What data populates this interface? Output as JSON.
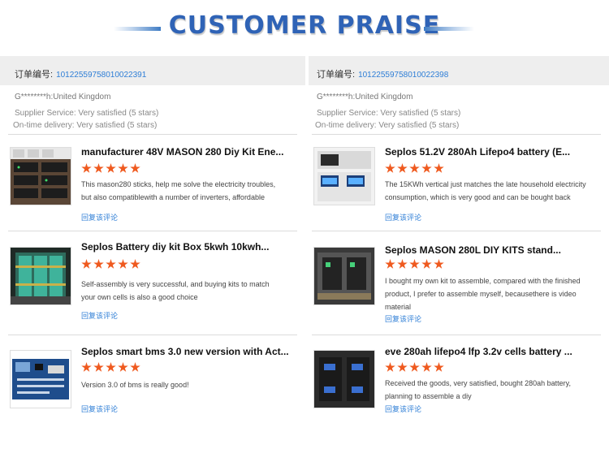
{
  "header": {
    "title": "CUSTOMER PRAISE"
  },
  "columns": [
    {
      "order_label": "订单编号:",
      "order_number": "10122559758010022391",
      "buyer": "G********h:United Kingdom",
      "supplier_service": "Supplier Service: Very satisfied (5 stars)",
      "delivery": "On-time delivery: Very satisfied (5 stars)",
      "items": [
        {
          "title": "manufacturer 48V MASON 280 Diy Kit Ene...",
          "stars": 5,
          "review_1": "This mason280 sticks, help me solve the electricity troubles,",
          "review_2": " but also compatiblewith a number of inverters, affordable",
          "review_3": "",
          "reply": "回复该评论"
        },
        {
          "title": "Seplos Battery diy kit Box 5kwh 10kwh...",
          "stars": 5,
          "review_1": "Self-assembly is very successful, and buying kits to match",
          "review_2": " your own cells is also a good choice",
          "review_3": "",
          "reply": "回复该评论"
        },
        {
          "title": "Seplos smart bms 3.0 new version with Act...",
          "stars": 5,
          "review_1": "Version 3.0 of bms is really good!",
          "review_2": "",
          "review_3": "",
          "reply": "回复该评论"
        }
      ]
    },
    {
      "order_label": "订单编号:",
      "order_number": "10122559758010022398",
      "buyer": "G********h:United Kingdom",
      "supplier_service": "Supplier Service: Very satisfied (5 stars)",
      "delivery": "On-time delivery: Very satisfied (5 stars)",
      "items": [
        {
          "title": "Seplos 51.2V 280Ah Lifepo4 battery (E...",
          "stars": 5,
          "review_1": "The 15KWh vertical just matches the late household electricity",
          "review_2": "consumption, which is very good and can be bought back",
          "review_3": "",
          "reply": "回复该评论"
        },
        {
          "title": "Seplos MASON 280L DIY KITS stand...",
          "stars": 5,
          "review_1": "I bought my own kit to assemble, compared with the finished",
          "review_2": "product, I prefer to assemble myself, becausethere is video",
          "review_3": "material",
          "reply": "回复该评论"
        },
        {
          "title": "eve 280ah lifepo4 lfp 3.2v cells battery ...",
          "stars": 5,
          "review_1": "Received the goods, very satisfied, bought 280ah battery,",
          "review_2": "planning to assemble a diy",
          "review_3": "",
          "reply": "回复该评论"
        }
      ]
    }
  ],
  "colors": {
    "title_blue": "#2f63b6",
    "star_orange": "#ef5a1f",
    "link_blue": "#2e7ed6"
  }
}
